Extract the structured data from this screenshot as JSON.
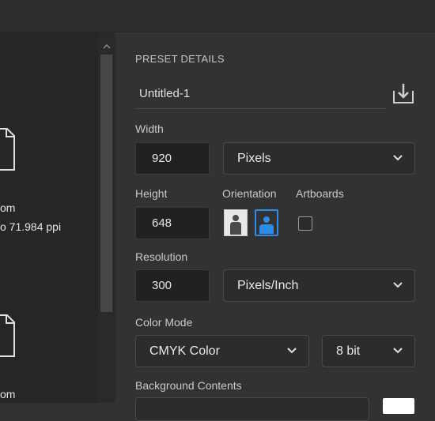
{
  "left": {
    "items": [
      {
        "icon": "document-icon",
        "line1": "om",
        "line2": "o 71.984 ppi"
      },
      {
        "icon": "document-icon",
        "line1": "om",
        "line2": ""
      }
    ]
  },
  "preset": {
    "section_title": "PRESET DETAILS",
    "name": "Untitled-1",
    "save_icon": "save-preset-icon"
  },
  "width": {
    "label": "Width",
    "value": "920",
    "unit": "Pixels"
  },
  "height": {
    "label": "Height",
    "value": "648"
  },
  "orientation": {
    "label": "Orientation",
    "selected": "landscape",
    "accent": "#2d8ceb"
  },
  "artboards": {
    "label": "Artboards",
    "checked": false
  },
  "resolution": {
    "label": "Resolution",
    "value": "300",
    "unit": "Pixels/Inch"
  },
  "color_mode": {
    "label": "Color Mode",
    "mode": "CMYK Color",
    "depth": "8 bit"
  },
  "background": {
    "label": "Background Contents",
    "swatch_color": "#ffffff"
  }
}
